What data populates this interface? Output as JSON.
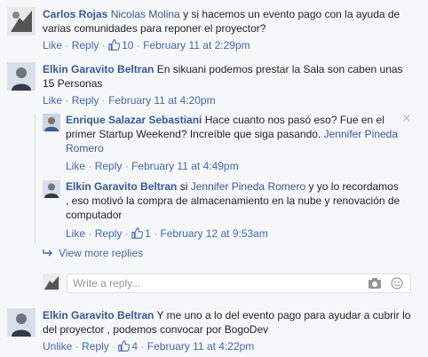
{
  "comments": [
    {
      "author": "Carlos Rojas",
      "mention": "Nicolas Molina",
      "text": " y si hacemos un evento pago con la ayuda de varias comunidades para reponer el proyector?",
      "like": "Like",
      "reply": "Reply",
      "likes": "10",
      "date": "February 11 at 2:29pm"
    },
    {
      "author": "Elkin Garavito Beltran",
      "text": " En sikuani podemos prestar la Sala son caben unas 15 Personas",
      "like": "Like",
      "reply": "Reply",
      "date": "February 11 at 4:20pm"
    }
  ],
  "replies": [
    {
      "author": "Enrique Salazar Sebastiani",
      "text": " Hace cuanto nos pasó eso? Fue en el primer Startup Weekend? Increíble que siga pasando. ",
      "mention": "Jennifer Pineda Romero",
      "like": "Like",
      "reply": "Reply",
      "date": "February 11 at 4:49pm"
    },
    {
      "author": "Elkin Garavito Beltran",
      "pre": " si ",
      "mention": "Jennifer Pineda Romero",
      "text": " y yo lo recordamos , eso motivó la compra de almacenamiento en la nube y renovación de computador",
      "like": "Like",
      "reply": "Reply",
      "likes": "1",
      "date": "February 12 at 9:53am"
    }
  ],
  "view_more": "View more replies",
  "reply_placeholder": "Write a reply...",
  "last_comment": {
    "author": "Elkin Garavito Beltran",
    "text": " Y me uno a lo del evento pago para ayudar a cubrir lo del proyector , podemos convocar por BogoDev",
    "unlike": "Unlike",
    "reply": "Reply",
    "likes": "4",
    "date": "February 11 at 4:22pm"
  },
  "close_symbol": "✕"
}
